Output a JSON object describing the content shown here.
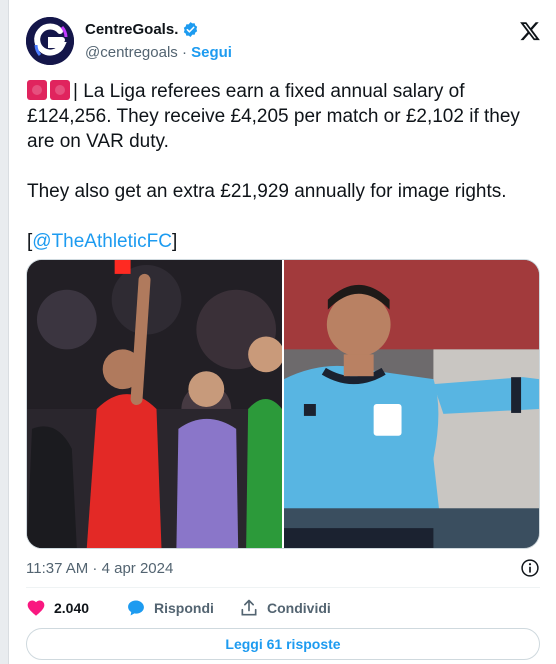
{
  "author": {
    "name": "CentreGoals.",
    "handle": "@centregoals",
    "separator": "·",
    "follow_label": "Segui",
    "avatar_letter": "G",
    "verified": true
  },
  "tweet": {
    "emoji": [
      "police-car-light",
      "police-car-light"
    ],
    "line1_text": "| La Liga referees earn a fixed annual salary of £124,256. They receive £4,205 per match or £2,102 if they are on VAR duty.",
    "line2_text": "They also get an extra £21,929 annually for image rights.",
    "link_open": "[",
    "link_text": "@TheAthleticFC",
    "link_close": "]"
  },
  "media": {
    "left_photo": "referee showing red card",
    "right_photo": "referee in blue kit pointing"
  },
  "meta": {
    "time": "11:37 AM · 4 apr 2024"
  },
  "actions": {
    "likes_count": "2.040",
    "reply_label": "Rispondi",
    "share_label": "Condividi"
  },
  "replies_button": "Leggi 61 risposte",
  "colors": {
    "accent": "#1d9bf0",
    "like": "#f91880",
    "text": "#0f1419",
    "secondary": "#536471"
  }
}
